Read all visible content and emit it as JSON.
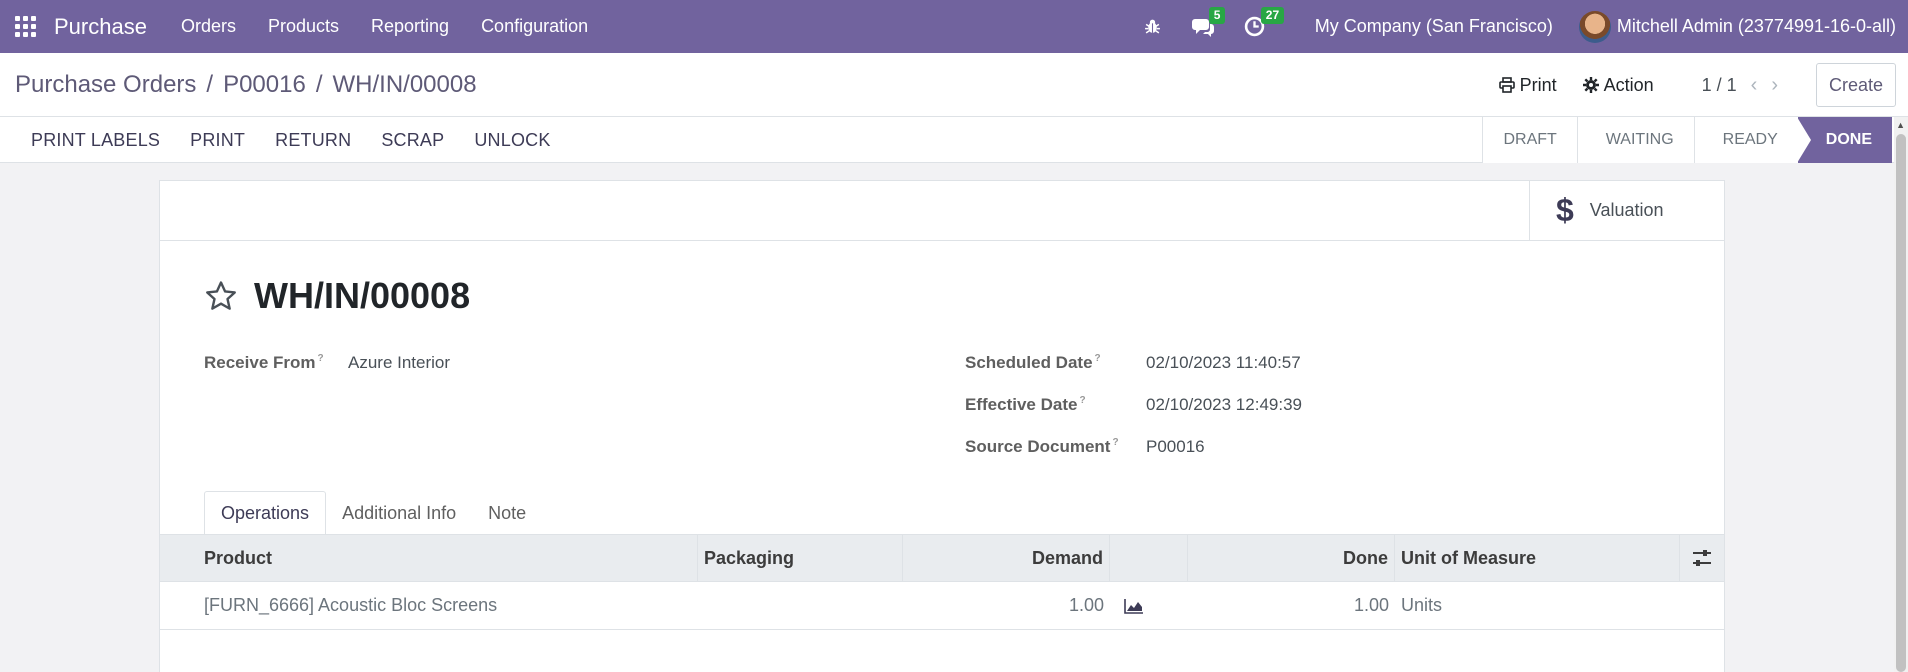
{
  "topnav": {
    "brand": "Purchase",
    "menu": [
      "Orders",
      "Products",
      "Reporting",
      "Configuration"
    ],
    "messages_count": "5",
    "activities_count": "27",
    "company": "My Company (San Francisco)",
    "user": "Mitchell Admin (23774991-16-0-all)"
  },
  "breadcrumb": {
    "items": [
      "Purchase Orders",
      "P00016"
    ],
    "separator": "/",
    "current": "WH/IN/00008"
  },
  "control": {
    "print": "Print",
    "action": "Action",
    "pager": "1 / 1",
    "create": "Create"
  },
  "statusbar": {
    "buttons": [
      "PRINT LABELS",
      "PRINT",
      "RETURN",
      "SCRAP",
      "UNLOCK"
    ],
    "stages": [
      "DRAFT",
      "WAITING",
      "READY",
      "DONE"
    ],
    "active_stage": "DONE"
  },
  "sheet": {
    "valuation_icon": "$",
    "valuation_label": "Valuation",
    "title": "WH/IN/00008",
    "receive_from_label": "Receive From",
    "receive_from_value": "Azure Interior",
    "scheduled_label": "Scheduled Date",
    "scheduled_value": "02/10/2023 11:40:57",
    "effective_label": "Effective Date",
    "effective_value": "02/10/2023 12:49:39",
    "source_label": "Source Document",
    "source_value": "P00016",
    "help_mark": "?",
    "tabs": [
      "Operations",
      "Additional Info",
      "Note"
    ]
  },
  "table": {
    "headers": {
      "product": "Product",
      "packaging": "Packaging",
      "demand": "Demand",
      "done": "Done",
      "uom": "Unit of Measure"
    },
    "rows": [
      {
        "product": "[FURN_6666] Acoustic Bloc Screens",
        "packaging": "",
        "demand": "1.00",
        "done": "1.00",
        "uom": "Units"
      }
    ]
  },
  "colors": {
    "brand": "#71639e",
    "badge": "#28a745"
  }
}
